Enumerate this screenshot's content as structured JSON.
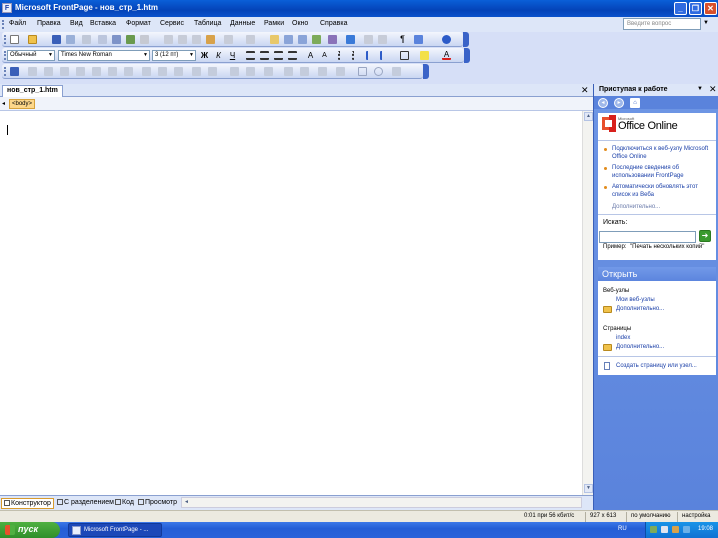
{
  "window": {
    "title": "Microsoft FrontPage - нов_стр_1.htm",
    "app_icon": "frontpage-icon"
  },
  "menu": {
    "items": [
      "Файл",
      "Правка",
      "Вид",
      "Вставка",
      "Формат",
      "Сервис",
      "Таблица",
      "Данные",
      "Рамки",
      "Окно",
      "Справка"
    ],
    "help_placeholder": "Введите вопрос"
  },
  "formatting": {
    "style": "Обычный",
    "font": "Times New Roman",
    "size": "3 (12 пт)"
  },
  "document": {
    "tab_label": "нов_стр_1.htm",
    "tag": "<body>"
  },
  "view_tabs": [
    "Конструктор",
    "С разделением",
    "Код",
    "Просмотр"
  ],
  "task_pane": {
    "title": "Приступая к работе",
    "logo_small": "Microsoft",
    "logo_text": "Office Online",
    "links": [
      "Подключиться к веб-узлу Microsoft Office Online",
      "Последние сведения об использовании FrontPage",
      "Автоматически обновлять этот список из Веба"
    ],
    "more1": "Дополнительно...",
    "search_label": "Искать:",
    "example_label": "Пример:",
    "example_text": "\"Печать нескольких копий\"",
    "open_title": "Открыть",
    "web_sites_label": "Веб-узлы",
    "my_web_sites": "Мои веб-узлы",
    "more2": "Дополнительно...",
    "pages_label": "Страницы",
    "index_link": "index",
    "more3": "Дополнительно...",
    "create_page": "Создать страницу или узел..."
  },
  "status": {
    "time_info": "0:01 при 56 кбит/с",
    "size": "927 x 613",
    "default_label": "по умолчанию",
    "custom_label": "настройка"
  },
  "taskbar": {
    "start": "пуск",
    "task_item": "Microsoft FrontPage - ...",
    "lang": "RU",
    "clock": "19:08"
  },
  "colors": {
    "title_bar": "#0443b8",
    "task_pane_bg": "#6e96e5",
    "accent_orange": "#e28c1c",
    "start_green": "#3a9a2e"
  }
}
